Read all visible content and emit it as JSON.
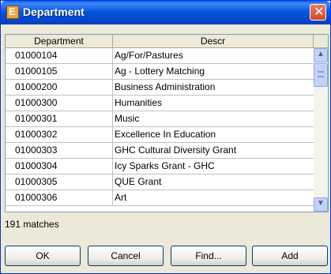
{
  "window": {
    "title": "Department",
    "app_icon_glyph": "E",
    "close_glyph": "✕"
  },
  "table": {
    "columns": [
      "Department",
      "Descr"
    ],
    "rows": [
      [
        "01000104",
        "Ag/For/Pastures"
      ],
      [
        "01000105",
        "Ag - Lottery Matching"
      ],
      [
        "01000200",
        "Business Administration"
      ],
      [
        "01000300",
        "Humanities"
      ],
      [
        "01000301",
        "Music"
      ],
      [
        "01000302",
        "Excellence In Education"
      ],
      [
        "01000303",
        "GHC Cultural Diversity Grant"
      ],
      [
        "01000304",
        "Icy Sparks Grant - GHC"
      ],
      [
        "01000305",
        "QUE Grant"
      ],
      [
        "01000306",
        "Art"
      ]
    ]
  },
  "status": {
    "matches": "191 matches"
  },
  "buttons": {
    "ok": "OK",
    "cancel": "Cancel",
    "find": "Find...",
    "add": "Add"
  },
  "scroll": {
    "up_glyph": "▲",
    "down_glyph": "▼"
  }
}
